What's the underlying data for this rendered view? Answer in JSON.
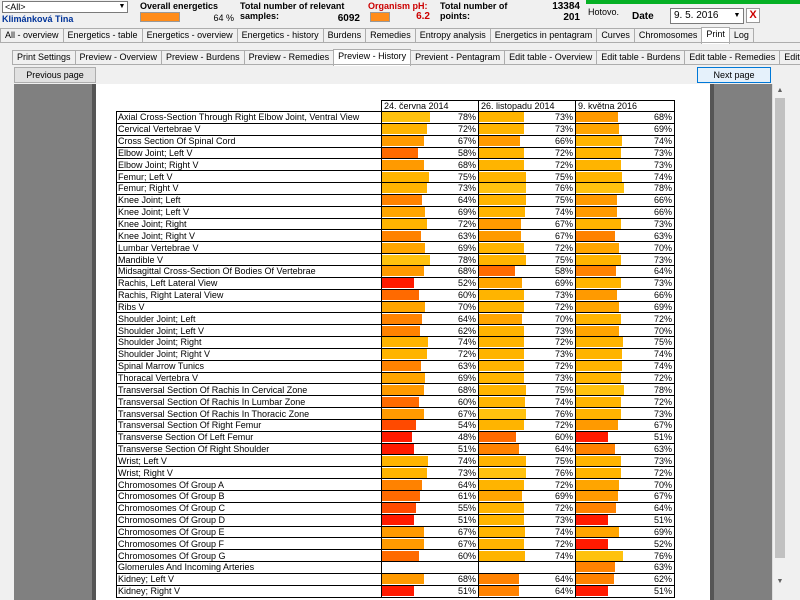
{
  "header": {
    "filter_value": "<All>",
    "patient_name": "Klimánková Tina",
    "overall_label": "Overall energetics",
    "overall_value": "64 %",
    "relevant_label": "Total number of relevant samples:",
    "relevant_value": "6092",
    "ph_label": "Organism pH:",
    "ph_value": "6.2",
    "points_label": "Total number of points:",
    "points_value": "13384",
    "points_value2": "201",
    "status": "Hotovo.",
    "date_label": "Date",
    "date_value": "9. 5. 2016",
    "close_label": "X",
    "accent_color": "#ff8c1a"
  },
  "main_tabs": [
    "All - overview",
    "Energetics - table",
    "Energetics - overview",
    "Energetics - history",
    "Burdens",
    "Remedies",
    "Entropy analysis",
    "Energetics in pentagram",
    "Curves",
    "Chromosomes",
    "Print",
    "Log"
  ],
  "main_tab_active": 10,
  "print_tabs": [
    "Print Settings",
    "Preview - Overview",
    "Preview - Burdens",
    "Preview - Remedies",
    "Preview - History",
    "Previent - Pentagram",
    "Edit table - Overview",
    "Edit table - Burdens",
    "Edit table - Remedies",
    "Edit table"
  ],
  "print_tab_active": 4,
  "nav": {
    "prev": "Previous page",
    "next": "Next page"
  },
  "table": {
    "columns": [
      "24. června 2014",
      "26. listopadu 2014",
      "9. května 2016"
    ],
    "rows": [
      {
        "name": "Axial Cross-Section Through Right Elbow Joint, Ventral View",
        "v": [
          78,
          73,
          68
        ]
      },
      {
        "name": "Cervical Vertebrae V",
        "v": [
          72,
          73,
          69
        ]
      },
      {
        "name": "Cross Section Of Spinal Cord",
        "v": [
          67,
          66,
          74
        ]
      },
      {
        "name": "Elbow Joint; Left V",
        "v": [
          58,
          72,
          73
        ]
      },
      {
        "name": "Elbow Joint; Right V",
        "v": [
          68,
          72,
          73
        ]
      },
      {
        "name": "Femur; Left V",
        "v": [
          75,
          75,
          74
        ]
      },
      {
        "name": "Femur; Right V",
        "v": [
          73,
          76,
          78
        ]
      },
      {
        "name": "Knee Joint; Left",
        "v": [
          64,
          75,
          66
        ]
      },
      {
        "name": "Knee Joint; Left V",
        "v": [
          69,
          74,
          66
        ]
      },
      {
        "name": "Knee Joint; Right",
        "v": [
          72,
          67,
          73
        ]
      },
      {
        "name": "Knee Joint; Right V",
        "v": [
          63,
          67,
          63
        ]
      },
      {
        "name": "Lumbar Vertebrae V",
        "v": [
          69,
          72,
          70
        ]
      },
      {
        "name": "Mandible V",
        "v": [
          78,
          75,
          73
        ]
      },
      {
        "name": "Midsagittal Cross-Section Of Bodies Of Vertebrae",
        "v": [
          68,
          58,
          64
        ]
      },
      {
        "name": "Rachis, Left Lateral View",
        "v": [
          52,
          69,
          73
        ]
      },
      {
        "name": "Rachis, Right Lateral View",
        "v": [
          60,
          73,
          66
        ]
      },
      {
        "name": "Ribs V",
        "v": [
          70,
          72,
          69
        ]
      },
      {
        "name": "Shoulder Joint; Left",
        "v": [
          64,
          70,
          72
        ]
      },
      {
        "name": "Shoulder Joint; Left V",
        "v": [
          62,
          73,
          70
        ]
      },
      {
        "name": "Shoulder Joint; Right",
        "v": [
          74,
          72,
          75
        ]
      },
      {
        "name": "Shoulder Joint; Right V",
        "v": [
          72,
          73,
          74
        ]
      },
      {
        "name": "Spinal Marrow Tunics",
        "v": [
          63,
          72,
          74
        ]
      },
      {
        "name": "Thoracal Vertebra V",
        "v": [
          69,
          73,
          72
        ]
      },
      {
        "name": "Transversal Section Of Rachis In Cervical Zone",
        "v": [
          68,
          75,
          78
        ]
      },
      {
        "name": "Transversal Section Of Rachis In Lumbar Zone",
        "v": [
          60,
          74,
          72
        ]
      },
      {
        "name": "Transversal Section Of Rachis In Thoracic Zone",
        "v": [
          67,
          76,
          73
        ]
      },
      {
        "name": "Transversal Section Of Right Femur",
        "v": [
          54,
          72,
          67
        ]
      },
      {
        "name": "Transverse Section Of Left Femur",
        "v": [
          48,
          60,
          51
        ]
      },
      {
        "name": "Transverse Section Of Right Shoulder",
        "v": [
          51,
          64,
          63
        ]
      },
      {
        "name": "Wrist; Left V",
        "v": [
          74,
          75,
          73
        ]
      },
      {
        "name": "Wrist; Right V",
        "v": [
          73,
          76,
          72
        ]
      },
      {
        "name": "Chromosomes Of Group A",
        "v": [
          64,
          72,
          70
        ]
      },
      {
        "name": "Chromosomes Of Group B",
        "v": [
          61,
          69,
          67
        ]
      },
      {
        "name": "Chromosomes Of Group C",
        "v": [
          55,
          72,
          64
        ]
      },
      {
        "name": "Chromosomes Of Group D",
        "v": [
          51,
          73,
          51
        ]
      },
      {
        "name": "Chromosomes Of Group E",
        "v": [
          67,
          74,
          69
        ]
      },
      {
        "name": "Chromosomes Of Group F",
        "v": [
          67,
          72,
          52
        ]
      },
      {
        "name": "Chromosomes Of Group G",
        "v": [
          60,
          74,
          76
        ]
      },
      {
        "name": "Glomerules And Incoming Arteries",
        "v": [
          null,
          null,
          63
        ]
      },
      {
        "name": "Kidney; Left V",
        "v": [
          68,
          64,
          62
        ]
      },
      {
        "name": "Kidney; Right V",
        "v": [
          51,
          64,
          51
        ]
      }
    ]
  }
}
